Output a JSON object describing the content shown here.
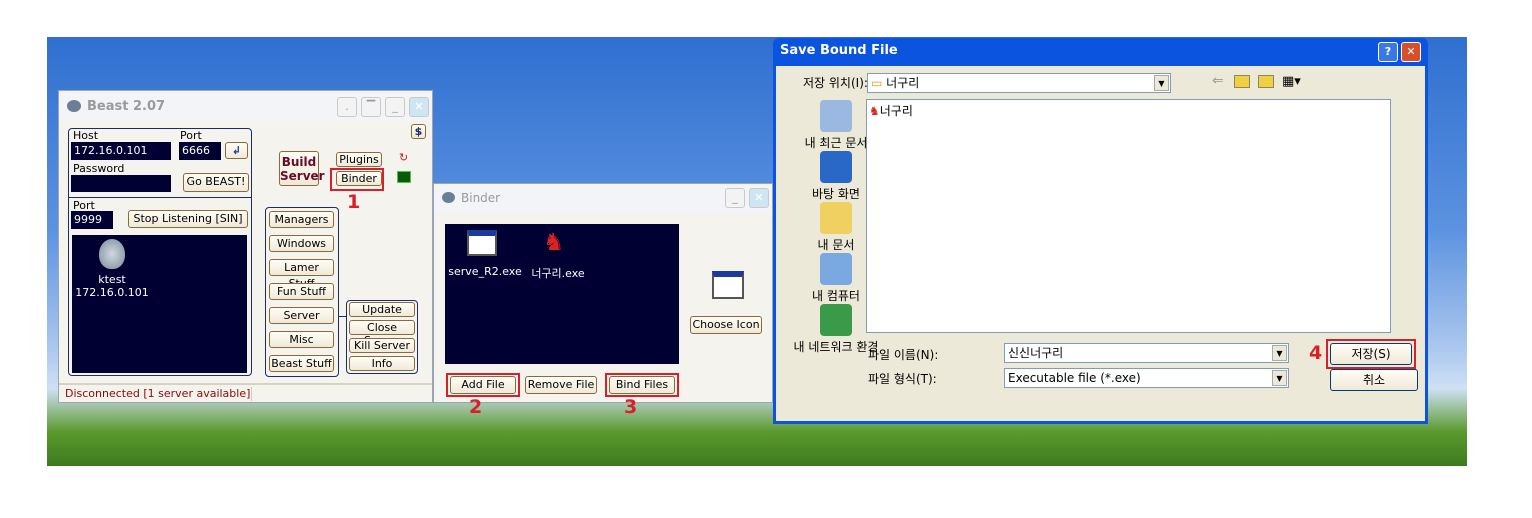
{
  "beast": {
    "title": "Beast 2.07",
    "host_label": "Host",
    "host": "172.16.0.101",
    "port_label": "Port",
    "port": "6666",
    "password_label": "Password",
    "password": "",
    "go": "Go BEAST!",
    "listen_port_label": "Port",
    "listen_port": "9999",
    "stop_listening": "Stop Listening [SIN]",
    "build_server": "Build Server",
    "plugins": "Plugins",
    "binder": "Binder",
    "menu": [
      "Managers",
      "Windows",
      "Lamer Stuff",
      "Fun Stuff",
      "Server",
      "Misc",
      "Beast Stuff"
    ],
    "server_menu": [
      "Update",
      "Close Server",
      "Kill Server",
      "Info"
    ],
    "victim": {
      "name": "ktest",
      "ip": "172.16.0.101"
    },
    "status": "Disconnected [1 server available]"
  },
  "binder": {
    "title": "Binder",
    "files": [
      "serve_R2.exe",
      "너구리.exe"
    ],
    "choose_icon": "Choose Icon",
    "add_file": "Add File",
    "remove_file": "Remove File",
    "bind_files": "Bind Files"
  },
  "save": {
    "title": "Save Bound File",
    "location_label": "저장 위치(I):",
    "location": "너구리",
    "places": [
      "내 최근 문서",
      "바탕 화면",
      "내 문서",
      "내 컴퓨터",
      "내 네트워크 환경"
    ],
    "items": [
      "너구리"
    ],
    "filename_label": "파일 이름(N):",
    "filename": "신신너구리",
    "filetype_label": "파일 형식(T):",
    "filetype": "Executable file (*.exe)",
    "save": "저장(S)",
    "cancel": "취소"
  },
  "steps": [
    "1",
    "2",
    "3",
    "4"
  ],
  "colors": {
    "highlight": "#d8202a",
    "field_bg": "#000033",
    "titlebar": "#0a54e0"
  }
}
